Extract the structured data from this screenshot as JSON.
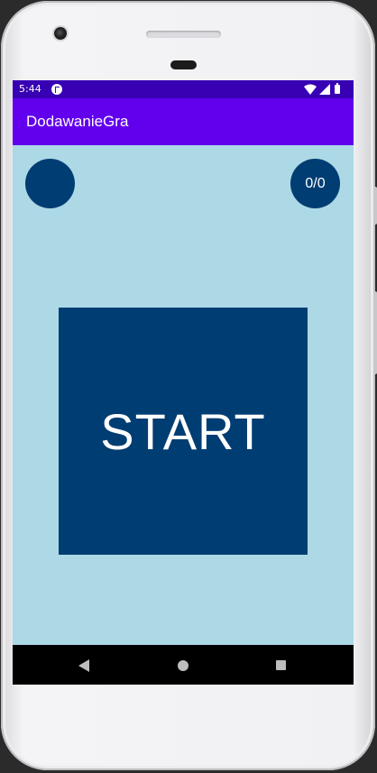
{
  "status_bar": {
    "time": "5:44",
    "icons": [
      "app-notification-icon",
      "wifi-icon",
      "signal-icon",
      "battery-icon"
    ]
  },
  "toolbar": {
    "title": "DodawanieGra"
  },
  "game": {
    "left_indicator_text": "",
    "score_text": "0/0",
    "start_label": "START"
  },
  "nav_bar": {
    "icons": [
      "back-icon",
      "home-icon",
      "recents-icon"
    ]
  },
  "colors": {
    "status_bar": "#3700b3",
    "toolbar": "#6200ee",
    "background": "#add8e6",
    "accent": "#003d73",
    "nav_bar": "#000000"
  }
}
